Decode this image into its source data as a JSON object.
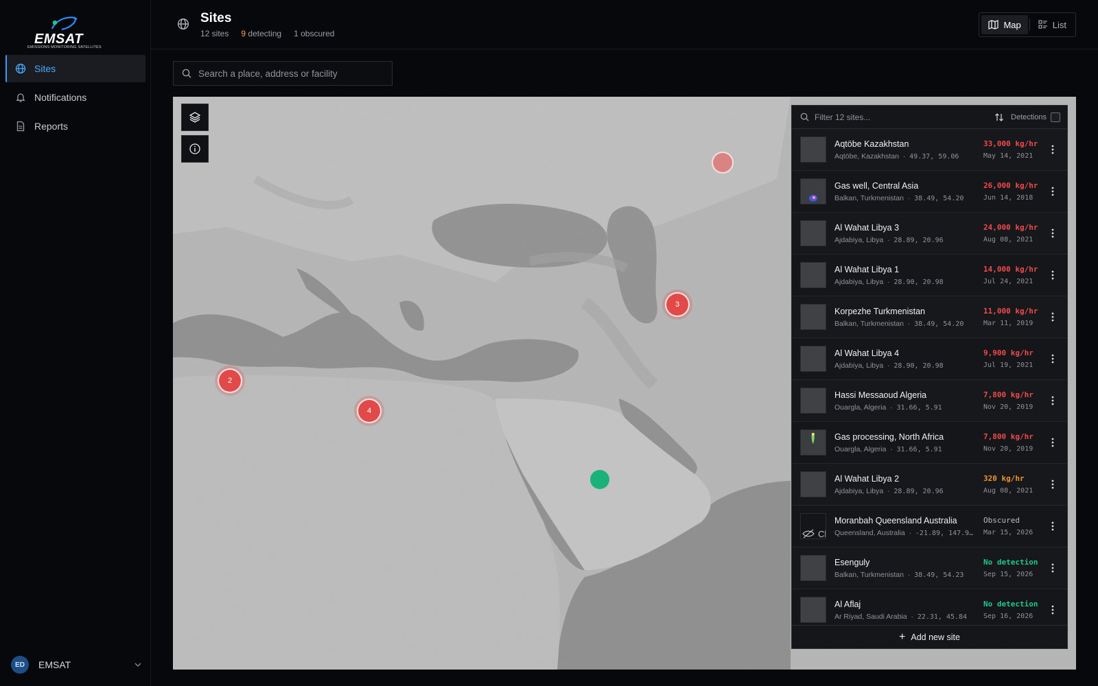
{
  "brand": {
    "name": "EMSAT",
    "tagline": "EMISSIONS MONITORING SATELLITES",
    "accent": "#3b9bff"
  },
  "sidebar": {
    "items": [
      {
        "label": "Sites",
        "icon": "globe-icon",
        "active": true
      },
      {
        "label": "Notifications",
        "icon": "bell-icon",
        "active": false
      },
      {
        "label": "Reports",
        "icon": "document-icon",
        "active": false
      }
    ],
    "user": {
      "initials": "ED",
      "name": "EMSAT"
    }
  },
  "header": {
    "title": "Sites",
    "sites_count": "12 sites",
    "detecting_count": "9",
    "detecting_label": "detecting",
    "obscured_count": "1 obscured",
    "view_map": "Map",
    "view_list": "List",
    "active_view": "Map"
  },
  "search": {
    "placeholder": "Search a place, address or facility"
  },
  "map": {
    "markers": [
      {
        "label": "3",
        "status": "detecting"
      },
      {
        "label": "2",
        "status": "detecting"
      },
      {
        "label": "4",
        "status": "detecting"
      },
      {
        "label": "",
        "status": "obscured"
      },
      {
        "label": "",
        "status": "no-detection"
      }
    ]
  },
  "panel": {
    "filter_placeholder": "Filter 12 sites...",
    "detections_label": "Detections",
    "detections_checked": false,
    "add_label": "Add new site",
    "sites": [
      {
        "name": "Aqtöbe Kazakhstan",
        "region": "Aqtöbe, Kazakhstan",
        "coords": "49.37, 59.06",
        "rate": "33,000 kg/hr",
        "date": "May 14, 2021",
        "level": "red"
      },
      {
        "name": "Gas well, Central Asia",
        "region": "Balkan, Turkmenistan",
        "coords": "38.49, 54.20",
        "rate": "26,000 kg/hr",
        "date": "Jun 14, 2018",
        "level": "red"
      },
      {
        "name": "Al Wahat Libya 3",
        "region": "Ajdabiya, Libya",
        "coords": "28.89, 20.96",
        "rate": "24,000 kg/hr",
        "date": "Aug 08, 2021",
        "level": "red"
      },
      {
        "name": "Al Wahat Libya 1",
        "region": "Ajdabiya, Libya",
        "coords": "28.90, 20.98",
        "rate": "14,000 kg/hr",
        "date": "Jul 24, 2021",
        "level": "red"
      },
      {
        "name": "Korpezhe Turkmenistan",
        "region": "Balkan, Turkmenistan",
        "coords": "38.49, 54.20",
        "rate": "11,000 kg/hr",
        "date": "Mar 11, 2019",
        "level": "red"
      },
      {
        "name": "Al Wahat Libya 4",
        "region": "Ajdabiya, Libya",
        "coords": "28.90, 20.98",
        "rate": "9,900 kg/hr",
        "date": "Jul 19, 2021",
        "level": "red"
      },
      {
        "name": "Hassi Messaoud Algeria",
        "region": "Ouargla, Algeria",
        "coords": "31.66, 5.91",
        "rate": "7,800 kg/hr",
        "date": "Nov 20, 2019",
        "level": "red"
      },
      {
        "name": "Gas processing, North Africa",
        "region": "Ouargla, Algeria",
        "coords": "31.66, 5.91",
        "rate": "7,800 kg/hr",
        "date": "Nov 20, 2019",
        "level": "red"
      },
      {
        "name": "Al Wahat Libya 2",
        "region": "Ajdabiya, Libya",
        "coords": "28.89, 20.96",
        "rate": "320 kg/hr",
        "date": "Aug 08, 2021",
        "level": "orange"
      },
      {
        "name": "Moranbah Queensland Australia",
        "region": "Queensland, Australia",
        "coords": "-21.89, 147.9…",
        "rate": "Obscured",
        "date": "Mar 15, 2026",
        "level": "grey"
      },
      {
        "name": "Esenguly",
        "region": "Balkan, Turkmenistan",
        "coords": "38.49, 54.23",
        "rate": "No detection",
        "date": "Sep 15, 2026",
        "level": "green"
      },
      {
        "name": "Al Aflaj",
        "region": "Ar Riyad, Saudi Arabia",
        "coords": "22.31, 45.84",
        "rate": "No detection",
        "date": "Sep 16, 2026",
        "level": "green"
      }
    ]
  }
}
